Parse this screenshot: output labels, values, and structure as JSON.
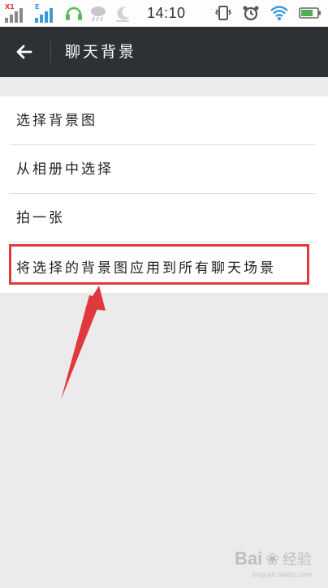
{
  "status_bar": {
    "time": "14:10",
    "sim1_tag": "X1",
    "sim2_tag": "E",
    "signal_color": "#3a9ad9",
    "battery_color": "#4caf50"
  },
  "toolbar": {
    "back_icon": "arrow-left-icon",
    "title": "聊天背景"
  },
  "options": [
    {
      "label": "选择背景图"
    },
    {
      "label": "从相册中选择"
    },
    {
      "label": "拍一张"
    },
    {
      "label": "将选择的背景图应用到所有聊天场景"
    }
  ],
  "annotation": {
    "highlight_color": "#e0383c"
  },
  "watermark": {
    "brand": "Bai",
    "sub": "经验",
    "url": "jingyan.baidu.com"
  }
}
